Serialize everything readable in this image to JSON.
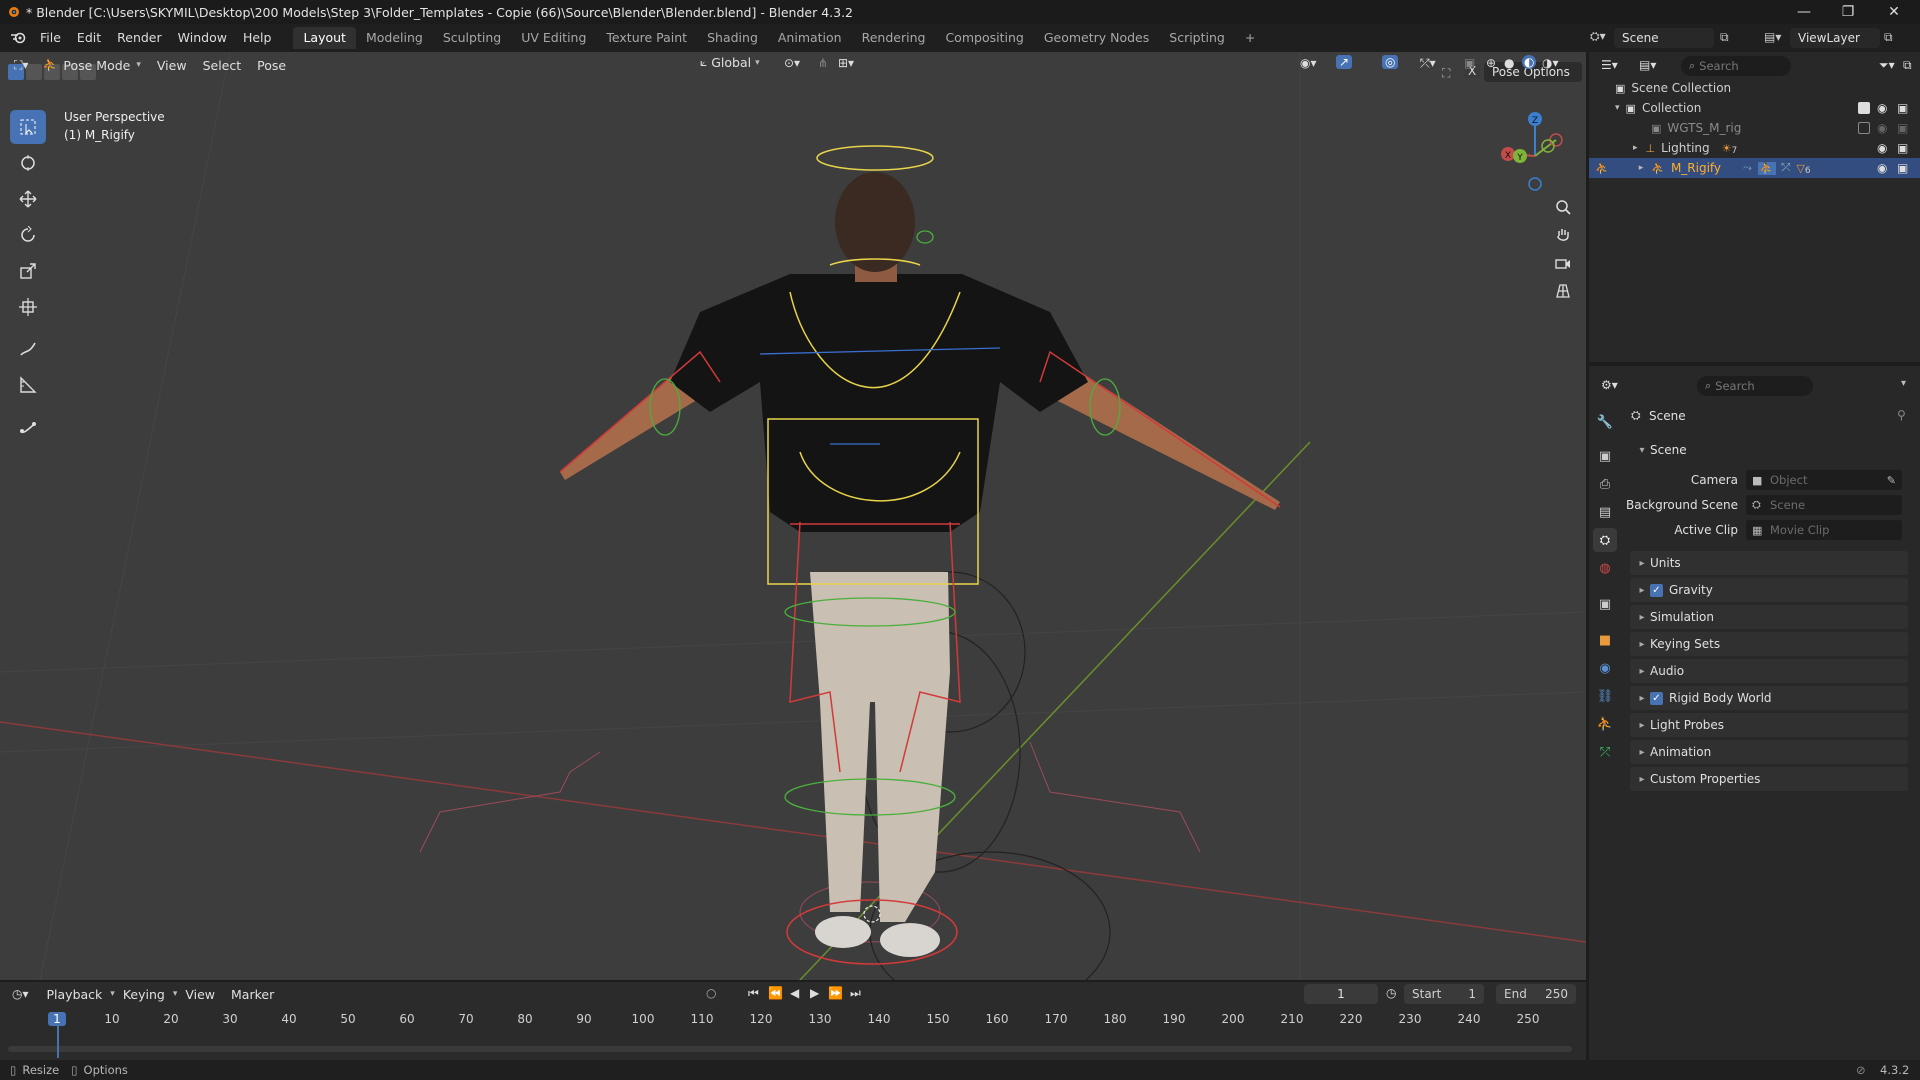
{
  "window": {
    "title": "* Blender [C:\\Users\\SKYMIL\\Desktop\\200 Models\\Step 3\\Folder_Templates - Copie (66)\\Source\\Blender\\Blender.blend] - Blender 4.3.2"
  },
  "menubar": {
    "menus": [
      "File",
      "Edit",
      "Render",
      "Window",
      "Help"
    ],
    "workspaces": [
      "Layout",
      "Modeling",
      "Sculpting",
      "UV Editing",
      "Texture Paint",
      "Shading",
      "Animation",
      "Rendering",
      "Compositing",
      "Geometry Nodes",
      "Scripting"
    ],
    "active_workspace": "Layout",
    "add_tab": "+",
    "scene_name": "Scene",
    "view_layer": "ViewLayer"
  },
  "viewport_header": {
    "mode": "Pose Mode",
    "menus": [
      "View",
      "Select",
      "Pose"
    ],
    "transform_orientation": "Global",
    "pose_options": "Pose Options"
  },
  "viewport": {
    "perspective": "User Perspective",
    "active_object": "(1) M_Rigify",
    "background_color": "#3d3d3d",
    "gizmo_axes": [
      "Z",
      "X",
      "Y"
    ]
  },
  "outliner": {
    "search_placeholder": "Search",
    "root": "Scene Collection",
    "items": [
      {
        "label": "Collection",
        "indent": 1
      },
      {
        "label": "WGTS_M_rig",
        "indent": 2
      },
      {
        "label": "Lighting",
        "indent": 2,
        "badge": "7"
      },
      {
        "label": "M_Rigify",
        "indent": 2,
        "selected": true,
        "badge": "6"
      }
    ]
  },
  "properties": {
    "search_placeholder": "Search",
    "context": "Scene",
    "panel_title": "Scene",
    "fields": [
      {
        "label": "Camera",
        "placeholder": "Object"
      },
      {
        "label": "Background Scene",
        "placeholder": "Scene"
      },
      {
        "label": "Active Clip",
        "placeholder": "Movie Clip"
      }
    ],
    "sections": [
      {
        "label": "Units",
        "checkbox": false
      },
      {
        "label": "Gravity",
        "checkbox": true
      },
      {
        "label": "Simulation",
        "checkbox": false
      },
      {
        "label": "Keying Sets",
        "checkbox": false
      },
      {
        "label": "Audio",
        "checkbox": false
      },
      {
        "label": "Rigid Body World",
        "checkbox": true
      },
      {
        "label": "Light Probes",
        "checkbox": false
      },
      {
        "label": "Animation",
        "checkbox": false
      },
      {
        "label": "Custom Properties",
        "checkbox": false
      }
    ]
  },
  "timeline": {
    "menus": [
      "Playback",
      "Keying",
      "View",
      "Marker"
    ],
    "current_frame": "1",
    "start_label": "Start",
    "start": "1",
    "end_label": "End",
    "end": "250",
    "ruler": [
      "1",
      "10",
      "20",
      "30",
      "40",
      "50",
      "60",
      "70",
      "80",
      "90",
      "100",
      "110",
      "120",
      "130",
      "140",
      "150",
      "160",
      "170",
      "180",
      "190",
      "200",
      "210",
      "220",
      "230",
      "240",
      "250"
    ]
  },
  "statusbar": {
    "left": [
      "Resize",
      "Options"
    ],
    "version": "4.3.2"
  },
  "colors": {
    "accent": "#4772b3",
    "bone_yellow": "#e8d44a",
    "bone_red": "#d23a3a",
    "bone_green": "#4ab03c",
    "axis_x": "#c54b4b",
    "axis_y": "#7fb33a"
  }
}
